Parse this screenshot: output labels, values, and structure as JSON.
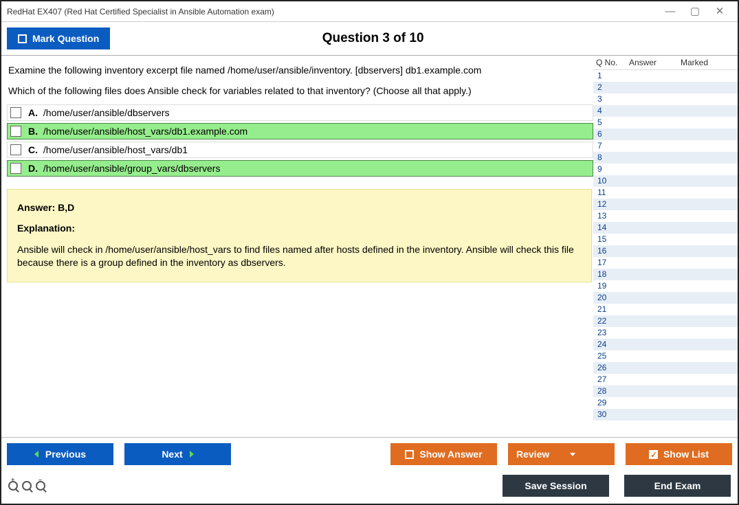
{
  "window": {
    "title": "RedHat EX407 (Red Hat Certified Specialist in Ansible Automation exam)"
  },
  "header": {
    "mark_label": "Mark Question",
    "question_header": "Question 3 of 10"
  },
  "question": {
    "line1": "Examine the following inventory excerpt file named /home/user/ansible/inventory. [dbservers] db1.example.com",
    "line2": "Which of the following files does Ansible check for variables related to that inventory? (Choose all that apply.)"
  },
  "choices": [
    {
      "letter": "A.",
      "text": "/home/user/ansible/dbservers",
      "correct": false
    },
    {
      "letter": "B.",
      "text": "/home/user/ansible/host_vars/db1.example.com",
      "correct": true
    },
    {
      "letter": "C.",
      "text": "/home/user/ansible/host_vars/db1",
      "correct": false
    },
    {
      "letter": "D.",
      "text": "/home/user/ansible/group_vars/dbservers",
      "correct": true
    }
  ],
  "answer": {
    "answer_label": "Answer: B,D",
    "explanation_label": "Explanation:",
    "explanation_body": "Ansible will check in /home/user/ansible/host_vars to find files named after hosts defined in the inventory. Ansible will check this file because there is a group defined in the inventory as dbservers."
  },
  "sidebar": {
    "col_qno": "Q No.",
    "col_answer": "Answer",
    "col_marked": "Marked",
    "rows": [
      "1",
      "2",
      "3",
      "4",
      "5",
      "6",
      "7",
      "8",
      "9",
      "10",
      "11",
      "12",
      "13",
      "14",
      "15",
      "16",
      "17",
      "18",
      "19",
      "20",
      "21",
      "22",
      "23",
      "24",
      "25",
      "26",
      "27",
      "28",
      "29",
      "30"
    ]
  },
  "footer": {
    "previous": "Previous",
    "next": "Next",
    "show_answer": "Show Answer",
    "review": "Review",
    "show_list": "Show List",
    "save_session": "Save Session",
    "end_exam": "End Exam"
  }
}
